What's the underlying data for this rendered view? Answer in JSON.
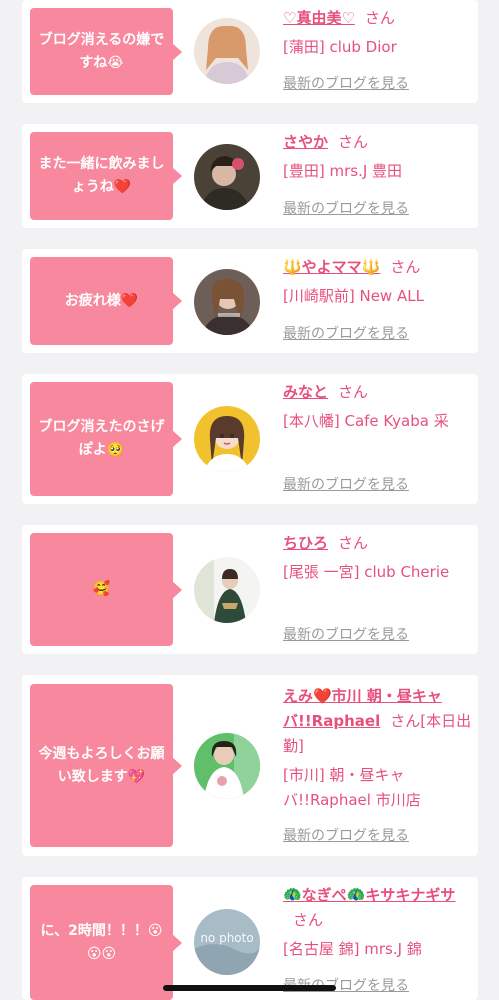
{
  "cards": [
    {
      "bubble": "ブログ消えるの嫌ですね😭",
      "name": "♡真由美♡",
      "honorific": "さん",
      "shop": "[蒲田] club Dior",
      "more": "最新のブログを見る",
      "avatar": "woman-portrait-photo"
    },
    {
      "bubble": "また一緒に飲みましょうね❤️",
      "name": "さやか",
      "honorific": "さん",
      "shop": "[豊田] mrs.J 豊田",
      "more": "最新のブログを見る",
      "avatar": "woman-portrait-photo"
    },
    {
      "bubble": "お疲れ様❤️",
      "name": "🔱やよママ🔱",
      "honorific": "さん",
      "shop": "[川崎駅前] New ALL",
      "more": "最新のブログを見る",
      "avatar": "woman-portrait-photo"
    },
    {
      "bubble": "ブログ消えたのさげぽよ🥺",
      "name": "みなと",
      "honorific": "さん",
      "shop": "[本八幡] Cafe Kyaba 采",
      "more": "最新のブログを見る",
      "avatar": "illustrated-woman"
    },
    {
      "bubble": "🥰",
      "name": "ちひろ",
      "honorific": "さん",
      "shop": "[尾張 一宮] club Cherie",
      "more": "最新のブログを見る",
      "avatar": "woman-kimono-photo"
    },
    {
      "bubble": "今週もよろしくお願い致します💖",
      "name": "えみ❤️市川 朝・昼キャバ!!Raphael",
      "honorific": "さん[本日出勤]",
      "shop": "[市川] 朝・昼キャバ!!Raphael 市川店",
      "more": "最新のブログを見る",
      "avatar": "woman-portrait-photo"
    },
    {
      "bubble": "に、2時間！！！😮😮😮",
      "name": "🦚なぎぺ🦚キサキナギサ",
      "honorific": "さん",
      "shop": "[名古屋 錦] mrs.J 錦",
      "more": "最新のブログを見る",
      "avatar": "no-photo-placeholder",
      "avatar_text": "no photo"
    }
  ],
  "colors": {
    "bubble": "#f7889d",
    "name": "#e8507c",
    "link": "#9a9a9a",
    "background": "#f2f2f4"
  }
}
